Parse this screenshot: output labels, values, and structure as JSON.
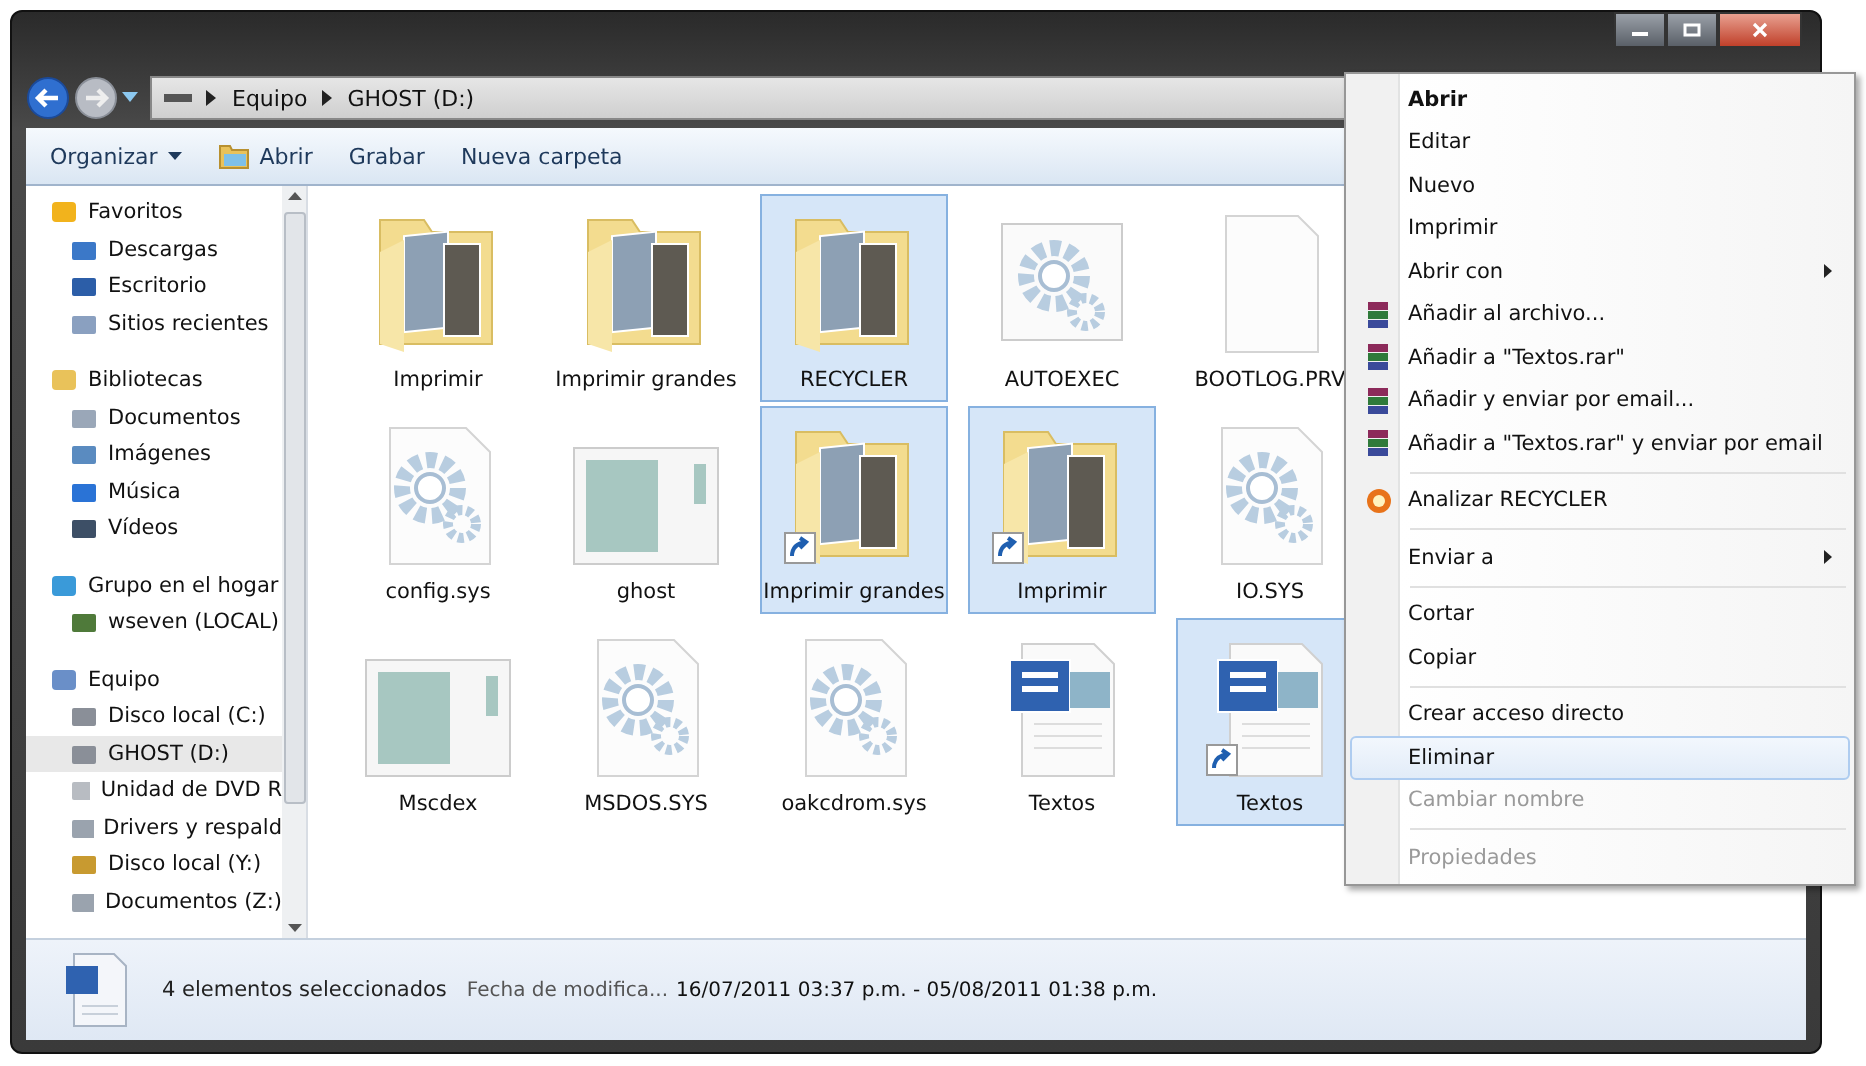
{
  "address_bar": {
    "crumbs": [
      "Equipo",
      "GHOST (D:)"
    ]
  },
  "toolbar": {
    "items": [
      {
        "label": "Organizar",
        "kind": "dropdown"
      },
      {
        "label": "Abrir",
        "kind": "open"
      },
      {
        "label": "Grabar",
        "kind": "plain"
      },
      {
        "label": "Nueva carpeta",
        "kind": "plain"
      }
    ]
  },
  "sidebar": {
    "groups": [
      {
        "label": "Favoritos",
        "children": [
          {
            "label": "Descargas",
            "selected": false
          },
          {
            "label": "Escritorio",
            "selected": false
          },
          {
            "label": "Sitios recientes",
            "selected": false
          }
        ]
      },
      {
        "label": "Bibliotecas",
        "children": [
          {
            "label": "Documentos",
            "selected": false
          },
          {
            "label": "Imágenes",
            "selected": false
          },
          {
            "label": "Música",
            "selected": false
          },
          {
            "label": "Vídeos",
            "selected": false
          }
        ]
      },
      {
        "label": "Grupo en el hogar",
        "children": [
          {
            "label": "wseven (LOCAL)",
            "selected": false
          }
        ]
      },
      {
        "label": "Equipo",
        "children": [
          {
            "label": "Disco local (C:)",
            "selected": false
          },
          {
            "label": "GHOST (D:)",
            "selected": true
          },
          {
            "label": "Unidad de DVD R",
            "selected": false
          },
          {
            "label": "Drivers y respald",
            "selected": false
          },
          {
            "label": "Disco local (Y:)",
            "selected": false
          },
          {
            "label": "Documentos (Z:)",
            "selected": false
          }
        ]
      }
    ]
  },
  "files": [
    {
      "name": "Imprimir",
      "kind": "folder",
      "shortcut": false,
      "selected": false
    },
    {
      "name": "Imprimir grandes",
      "kind": "folder",
      "shortcut": false,
      "selected": false
    },
    {
      "name": "RECYCLER",
      "kind": "folder",
      "shortcut": false,
      "selected": true
    },
    {
      "name": "AUTOEXEC",
      "kind": "gear-window",
      "shortcut": false,
      "selected": false
    },
    {
      "name": "BOOTLOG.PRV",
      "kind": "blank",
      "shortcut": false,
      "selected": false
    },
    {
      "name": "config.sys",
      "kind": "gear",
      "shortcut": false,
      "selected": false
    },
    {
      "name": "ghost",
      "kind": "window",
      "shortcut": false,
      "selected": false
    },
    {
      "name": "Imprimir grandes",
      "kind": "folder",
      "shortcut": true,
      "selected": true
    },
    {
      "name": "Imprimir",
      "kind": "folder",
      "shortcut": true,
      "selected": true
    },
    {
      "name": "IO.SYS",
      "kind": "gear",
      "shortcut": false,
      "selected": false
    },
    {
      "name": "Mscdex",
      "kind": "window",
      "shortcut": false,
      "selected": false
    },
    {
      "name": "MSDOS.SYS",
      "kind": "gear",
      "shortcut": false,
      "selected": false
    },
    {
      "name": "oakcdrom.sys",
      "kind": "gear",
      "shortcut": false,
      "selected": false
    },
    {
      "name": "Textos",
      "kind": "word",
      "shortcut": false,
      "selected": false
    },
    {
      "name": "Textos",
      "kind": "word",
      "shortcut": true,
      "selected": true
    }
  ],
  "context_menu": {
    "groups": [
      [
        {
          "label": "Abrir",
          "default": true
        },
        {
          "label": "Editar"
        },
        {
          "label": "Nuevo"
        },
        {
          "label": "Imprimir"
        },
        {
          "label": "Abrir con",
          "submenu": true
        },
        {
          "label": "Añadir al archivo...",
          "kind": "archive"
        },
        {
          "label": "Añadir a \"Textos.rar\"",
          "kind": "archive"
        },
        {
          "label": "Añadir y enviar por email...",
          "kind": "archive"
        },
        {
          "label": "Añadir a \"Textos.rar\" y enviar por email",
          "kind": "archive"
        }
      ],
      [
        {
          "label": "Analizar RECYCLER",
          "kind": "scan"
        }
      ],
      [
        {
          "label": "Enviar a",
          "submenu": true
        }
      ],
      [
        {
          "label": "Cortar"
        },
        {
          "label": "Copiar"
        }
      ],
      [
        {
          "label": "Crear acceso directo"
        },
        {
          "label": "Eliminar",
          "highlighted": true
        },
        {
          "label": "Cambiar nombre",
          "disabled": true
        }
      ],
      [
        {
          "label": "Propiedades",
          "disabled": true
        }
      ]
    ]
  },
  "status_bar": {
    "count": "4 elementos seleccionados",
    "date_label": "Fecha de modifica...",
    "date_value": "16/07/2011 03:37 p.m. - 05/08/2011 01:38 p.m."
  }
}
